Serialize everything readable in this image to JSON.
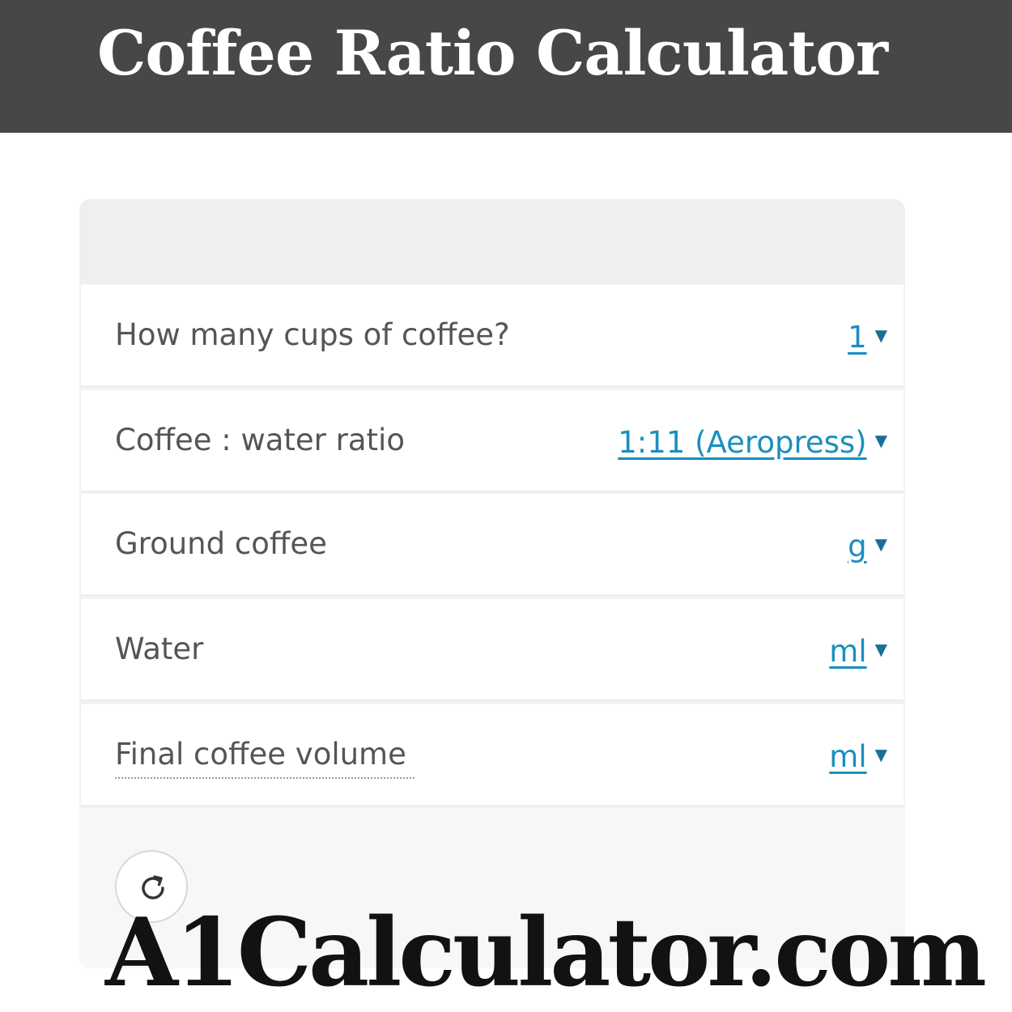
{
  "header": {
    "title": "Coffee Ratio Calculator"
  },
  "calculator": {
    "rows": [
      {
        "label": "How many cups of coffee?",
        "value": "1"
      },
      {
        "label": "Coffee : water ratio",
        "value": "1:11 (Aeropress)"
      },
      {
        "label": "Ground coffee",
        "value": "g"
      },
      {
        "label": "Water",
        "value": "ml"
      },
      {
        "label": "Final coffee volume",
        "value": "ml"
      }
    ],
    "reset_icon": "refresh-icon"
  },
  "watermark": {
    "text": "A1Calculator.com"
  },
  "colors": {
    "header_bg": "#464749",
    "link": "#1a8fbf",
    "label_text": "#555555"
  }
}
